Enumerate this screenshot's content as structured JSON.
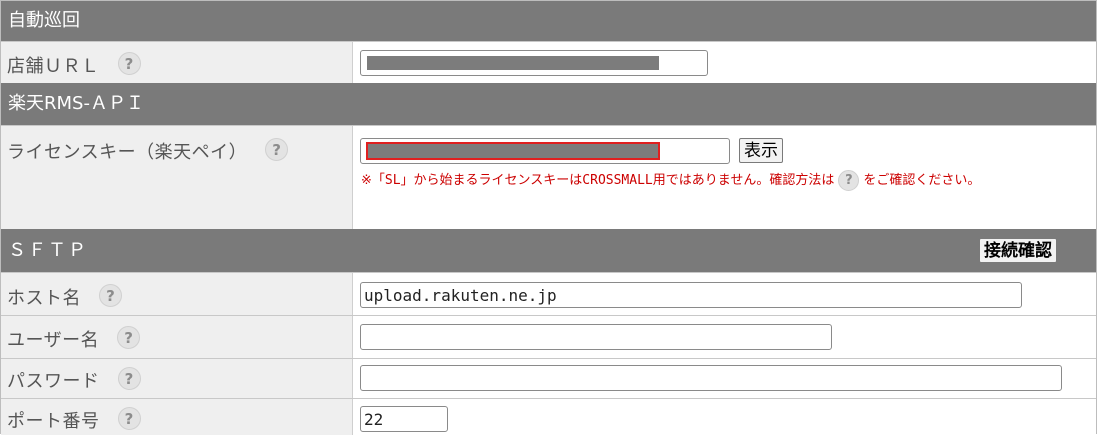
{
  "colors": {
    "header_bg": "#7a7a7a",
    "label_bg": "#efefef",
    "notice_text": "#cc0000",
    "error_outline": "#e02020"
  },
  "help_icon": "?",
  "sections": {
    "auto_patrol": {
      "title": "自動巡回",
      "shop_url": {
        "label": "店舗ＵＲＬ",
        "value": ""
      }
    },
    "rakuten_api": {
      "title": "楽天RMS-ＡＰＩ",
      "license_key": {
        "label": "ライセンスキー（楽天ペイ）",
        "value": "",
        "show_button": "表示",
        "notice_before": "※「SL」から始まるライセンスキーはCROSSMALL用ではありません。確認方法は",
        "notice_after": "をご確認ください。"
      }
    },
    "sftp": {
      "title": "ＳＦＴＰ",
      "connect_button": "接続確認",
      "host": {
        "label": "ホスト名",
        "value": "upload.rakuten.ne.jp"
      },
      "username": {
        "label": "ユーザー名",
        "value": ""
      },
      "password": {
        "label": "パスワード",
        "value": ""
      },
      "port": {
        "label": "ポート番号",
        "value": "22"
      }
    }
  }
}
